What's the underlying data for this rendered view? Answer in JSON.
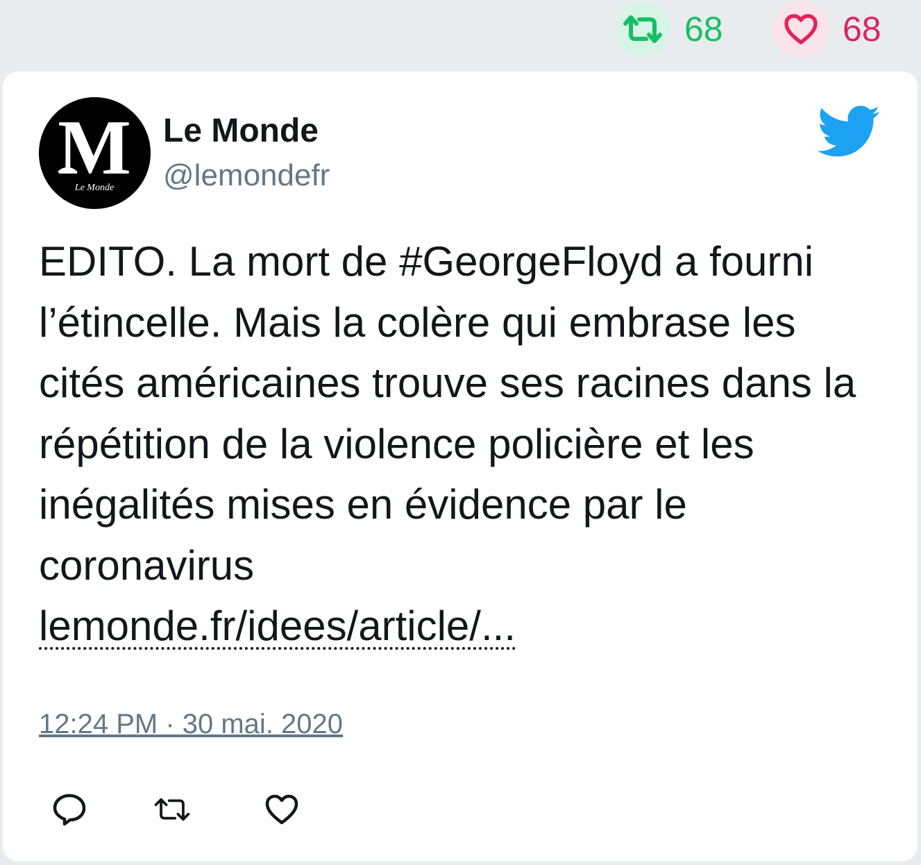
{
  "header_stats": {
    "retweets": "68",
    "likes": "68",
    "retweet_color": "#17bf63",
    "like_color": "#e0245e"
  },
  "tweet": {
    "author_name": "Le Monde",
    "author_handle": "@lemondefr",
    "avatar_icon": "le-monde-logo",
    "brand_icon": "twitter-bird-icon",
    "brand_color": "#1da1f2",
    "text": "EDITO. La mort de #GeorgeFloyd a fourni l’étincelle. Mais la colère qui embrase les cités américaines trouve ses racines dans la répétition de la violence policière et les inégalités mises en évidence par le coronavirus",
    "link_text": "lemonde.fr/idees/article/...",
    "timestamp": "12:24 PM · 30 mai. 2020"
  },
  "actions": [
    {
      "icon": "reply-icon"
    },
    {
      "icon": "retweet-icon"
    },
    {
      "icon": "like-icon"
    }
  ]
}
